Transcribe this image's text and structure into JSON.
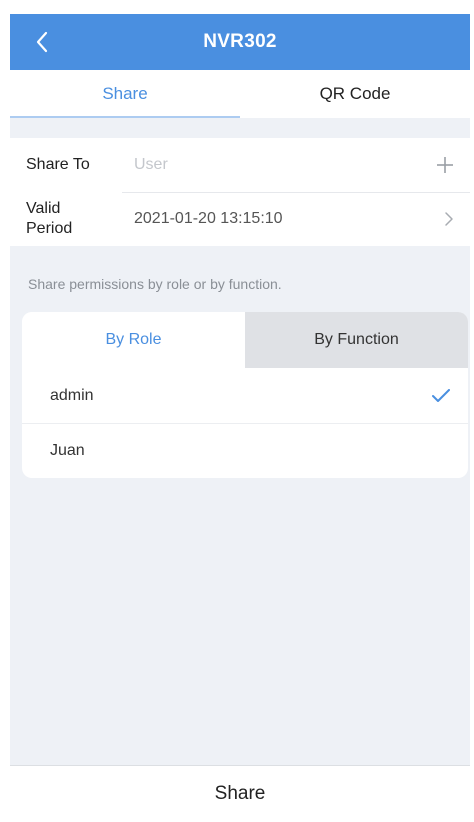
{
  "header": {
    "title": "NVR302",
    "back_icon": "chevron-left-icon"
  },
  "tabs": [
    {
      "label": "Share",
      "active": true
    },
    {
      "label": "QR Code",
      "active": false
    }
  ],
  "form": {
    "share_to": {
      "label": "Share To",
      "placeholder": "User",
      "icon": "plus-icon"
    },
    "valid_period": {
      "label_line1": "Valid",
      "label_line2": "Period",
      "value": "2021-01-20 13:15:10",
      "icon": "chevron-right-icon"
    }
  },
  "hint": "Share permissions by role or by function.",
  "segment": {
    "options": [
      {
        "label": "By Role",
        "active": true
      },
      {
        "label": "By Function",
        "active": false
      }
    ]
  },
  "roles": [
    {
      "name": "admin",
      "selected": true
    },
    {
      "name": "Juan",
      "selected": false
    }
  ],
  "footer": {
    "share_button": "Share"
  },
  "colors": {
    "accent": "#4a8fe0",
    "background": "#eef1f6"
  }
}
